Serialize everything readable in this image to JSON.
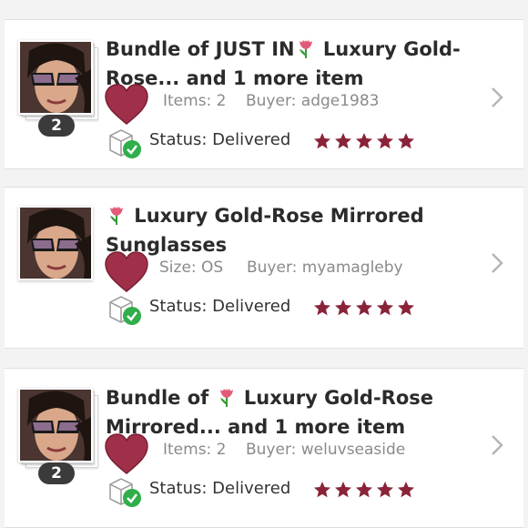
{
  "orders": [
    {
      "title_pre": "Bundle of JUST IN",
      "title_post": " Luxury Gold-Rose... and 1 more item",
      "count_badge": "2",
      "meta1": "Items: 2",
      "meta2": "Buyer: adge1983",
      "status": "Status: Delivered",
      "rating": 5
    },
    {
      "title_pre": "",
      "title_post": " Luxury Gold-Rose Mirrored Sunglasses",
      "count_badge": "",
      "meta1": "Size: OS",
      "meta2": "Buyer: myamagleby",
      "status": "Status: Delivered",
      "rating": 5
    },
    {
      "title_pre": "Bundle of ",
      "title_post": " Luxury Gold-Rose Mirrored... and 1 more item",
      "count_badge": "2",
      "meta1": "Items: 2",
      "meta2": "Buyer: weluvseaside",
      "status": "Status: Delivered",
      "rating": 5
    }
  ],
  "colors": {
    "star": "#8a2339",
    "heart": "#9b2b44",
    "check": "#2fae4a",
    "badge": "#3b3b3b"
  },
  "icons": [
    "tulip-emoji-icon",
    "heart-icon",
    "package-delivered-icon",
    "star-icon",
    "chevron-right-icon"
  ]
}
